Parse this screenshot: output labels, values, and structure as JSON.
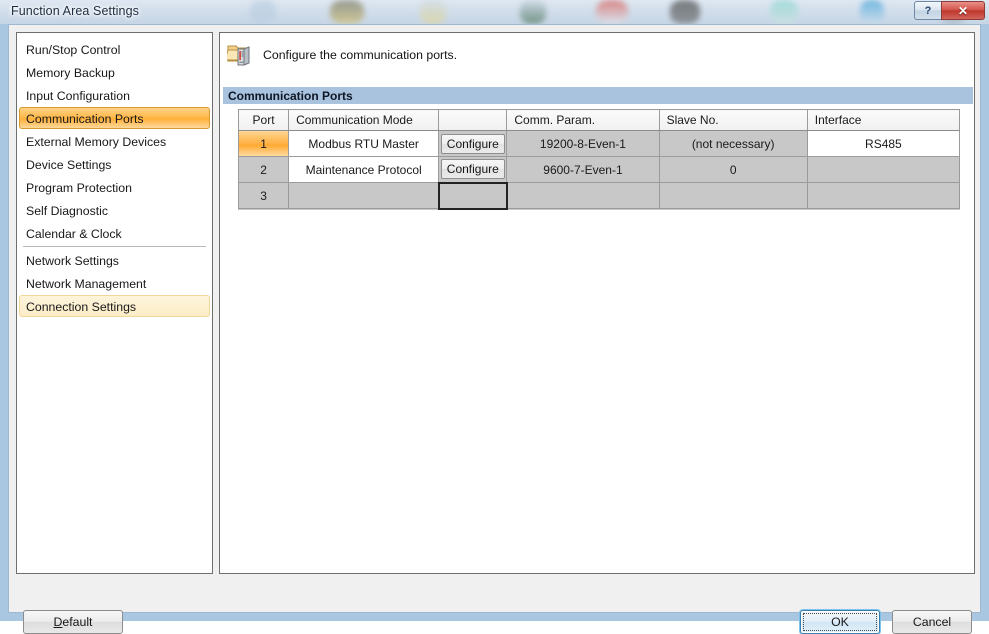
{
  "window": {
    "title": "Function Area Settings",
    "help_button": "?",
    "close_button": "✕"
  },
  "sidebar": {
    "items": [
      {
        "label": "Run/Stop Control",
        "state": "normal"
      },
      {
        "label": "Memory Backup",
        "state": "normal"
      },
      {
        "label": "Input Configuration",
        "state": "normal"
      },
      {
        "label": "Communication Ports",
        "state": "selected"
      },
      {
        "label": "External Memory Devices",
        "state": "normal"
      },
      {
        "label": "Device Settings",
        "state": "normal"
      },
      {
        "label": "Program Protection",
        "state": "normal"
      },
      {
        "label": "Self Diagnostic",
        "state": "normal"
      },
      {
        "label": "Calendar & Clock",
        "state": "normal"
      },
      {
        "label": "Network Settings",
        "state": "normal"
      },
      {
        "label": "Network Management",
        "state": "normal"
      },
      {
        "label": "Connection Settings",
        "state": "hovered"
      }
    ]
  },
  "content": {
    "description": "Configure the communication ports.",
    "description_icon": "communication-ports-icon",
    "section_title": "Communication Ports",
    "table": {
      "columns": [
        "Port",
        "Communication Mode",
        "",
        "Comm. Param.",
        "Slave No.",
        "Interface"
      ],
      "rows": [
        {
          "port": "1",
          "mode": "Modbus RTU Master",
          "configure_label": "Configure",
          "comm_param": "19200-8-Even-1",
          "slave_no": "(not necessary)",
          "interface": "RS485"
        },
        {
          "port": "2",
          "mode": "Maintenance Protocol",
          "configure_label": "Configure",
          "comm_param": "9600-7-Even-1",
          "slave_no": "0",
          "interface": ""
        },
        {
          "port": "3",
          "mode": "",
          "configure_label": "",
          "comm_param": "",
          "slave_no": "",
          "interface": ""
        }
      ]
    }
  },
  "footer": {
    "default_label": "Default",
    "default_accel": "D",
    "ok_label": "OK",
    "cancel_label": "Cancel"
  },
  "colors": {
    "selected_orange": "#ffb44a",
    "hover_yellow": "#fcedc6",
    "section_band_blue": "#a9c2dd",
    "grid_gray": "#c8c8c8",
    "close_red": "#bd362d",
    "focus_blue": "#3c7fb1"
  }
}
